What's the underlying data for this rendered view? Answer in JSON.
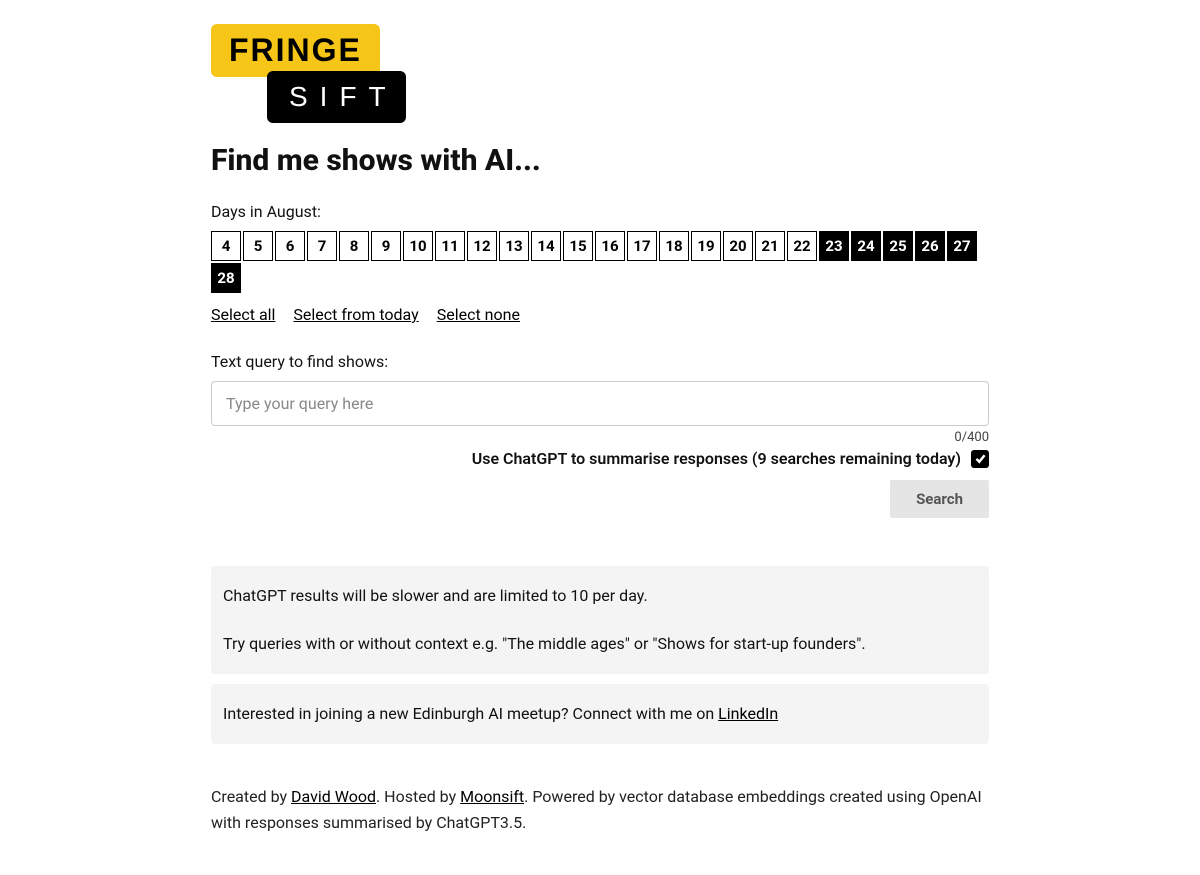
{
  "logo": {
    "top": "FRINGE",
    "bottom": "SIFT"
  },
  "heading": "Find me shows with AI...",
  "days_label": "Days in August:",
  "days": [
    {
      "n": "4",
      "sel": false
    },
    {
      "n": "5",
      "sel": false
    },
    {
      "n": "6",
      "sel": false
    },
    {
      "n": "7",
      "sel": false
    },
    {
      "n": "8",
      "sel": false
    },
    {
      "n": "9",
      "sel": false
    },
    {
      "n": "10",
      "sel": false
    },
    {
      "n": "11",
      "sel": false
    },
    {
      "n": "12",
      "sel": false
    },
    {
      "n": "13",
      "sel": false
    },
    {
      "n": "14",
      "sel": false
    },
    {
      "n": "15",
      "sel": false
    },
    {
      "n": "16",
      "sel": false
    },
    {
      "n": "17",
      "sel": false
    },
    {
      "n": "18",
      "sel": false
    },
    {
      "n": "19",
      "sel": false
    },
    {
      "n": "20",
      "sel": false
    },
    {
      "n": "21",
      "sel": false
    },
    {
      "n": "22",
      "sel": false
    },
    {
      "n": "23",
      "sel": true
    },
    {
      "n": "24",
      "sel": true
    },
    {
      "n": "25",
      "sel": true
    },
    {
      "n": "26",
      "sel": true
    },
    {
      "n": "27",
      "sel": true
    },
    {
      "n": "28",
      "sel": true
    }
  ],
  "select_links": {
    "all": "Select all",
    "from_today": "Select from today",
    "none": "Select none"
  },
  "query": {
    "label": "Text query to find shows:",
    "placeholder": "Type your query here",
    "char_count": "0/400"
  },
  "chatgpt_toggle": {
    "label": "Use ChatGPT to summarise responses (9 searches remaining today)",
    "checked": true
  },
  "search_button": "Search",
  "info1": {
    "line1": "ChatGPT results will be slower and are limited to 10 per day.",
    "line2": "Try queries with or without context e.g. \"The middle ages\" or \"Shows for start-up founders\"."
  },
  "info2": {
    "prefix": "Interested in joining a new Edinburgh AI meetup? Connect with me on ",
    "link": "LinkedIn"
  },
  "footer": {
    "t1": "Created by ",
    "a1": "David Wood",
    "t2": ". Hosted by ",
    "a2": "Moonsift",
    "t3": ". Powered by vector database embeddings created using OpenAI with responses summarised by ChatGPT3.5."
  }
}
